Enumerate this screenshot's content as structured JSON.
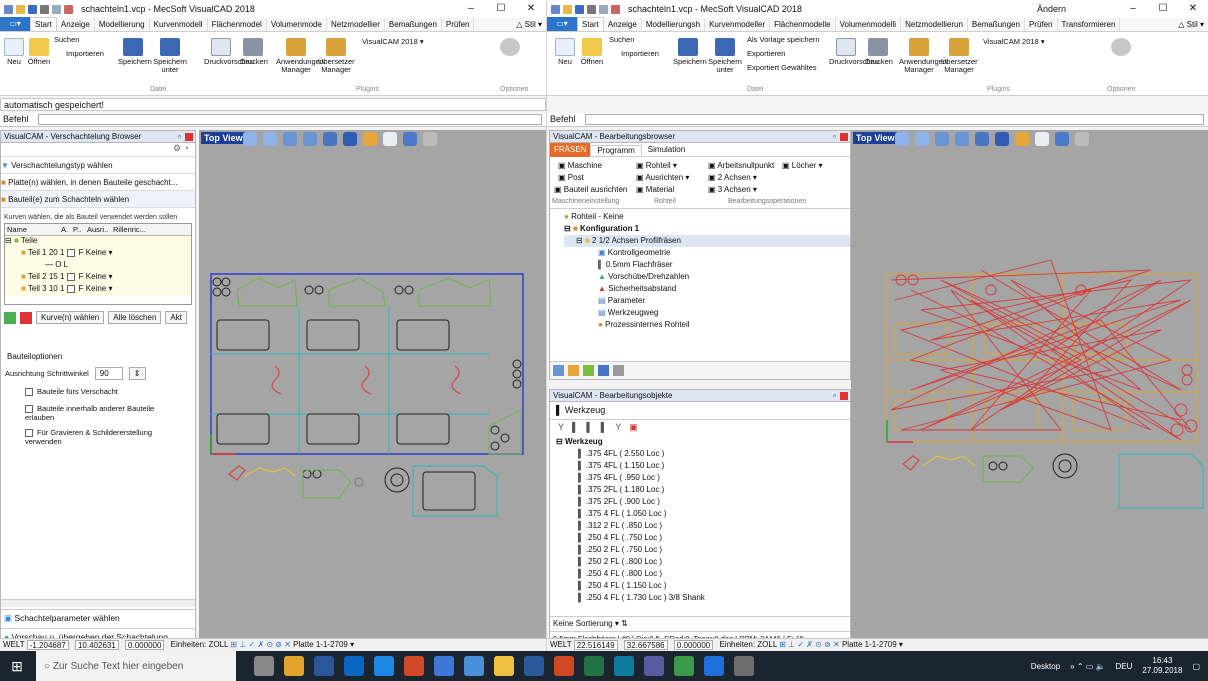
{
  "colors": {
    "accent": "#2b74c7",
    "panel_header": "#dde6f2",
    "viewport_bg": "#a5a5a5",
    "topview_bg": "#1c3f9c"
  },
  "left_window": {
    "title": "schachteln1.vcp - MecSoft VisualCAD 2018",
    "tabs": [
      "Start",
      "Anzeige",
      "Modellierung",
      "Kurvenmodell",
      "Flächenmodel",
      "Volumenmode",
      "Netzmodellier",
      "Bemaßungen",
      "Prüfen"
    ],
    "style_label": "Stil",
    "ribbon": {
      "neu": "Neu",
      "oeffnen": "Öffnen",
      "suchen": "Suchen",
      "importieren": "Importieren",
      "speichern": "Speichern",
      "speichern_unter": "Speichern unter",
      "druckvorschau": "Druckvorschau",
      "drucken": "Drucken",
      "anwendungen": "Anwendungen Manager",
      "uebersetzer": "Übersetzer Manager",
      "visualcam": "VisualCAM 2018",
      "group_datei": "Datei",
      "group_plugins": "Plugins",
      "group_optionen": "Optionen"
    },
    "cmd_history": "automatisch gespeichert!",
    "befehl_label": "Befehl",
    "nesting_panel": {
      "title": "VisualCAM - Verschachtelung Browser",
      "steps": [
        "Verschachtelungstyp wählen",
        "Platte(n) wählen, in denen Bauteile geschacht...",
        "Bauteil(e) zum Schachteln wählen"
      ],
      "hint": "Kurven wählen, die als Bauteil verwendet werden sollen",
      "columns": [
        "Name",
        "A.",
        "P..",
        "Ausri..",
        "Rillenric..."
      ],
      "tree_root": "Teile",
      "parts": [
        {
          "name": "Teil 1",
          "a": "20",
          "p": "1",
          "ausri": "F",
          "rille": "Keine"
        },
        {
          "name": "O L",
          "a": "",
          "p": "",
          "ausri": "",
          "rille": ""
        },
        {
          "name": "Teil 2",
          "a": "15",
          "p": "1",
          "ausri": "F",
          "rille": "Keine"
        },
        {
          "name": "Teil 3",
          "a": "10",
          "p": "1",
          "ausri": "F",
          "rille": "Keine"
        }
      ],
      "btn_kurven": "Kurve(n) wählen",
      "btn_loeschen": "Alle löschen",
      "btn_akt": "Akt",
      "options_title": "Bauteiloptionen",
      "angle_label": "Ausrichtung Schrittwinkel",
      "angle_value": "90",
      "checkboxes": [
        "Bauteile fürs Verschacht",
        "Bauteile innerhalb anderer Bauteile erlauben",
        "Für Gravieren & Schildererstellung verwenden"
      ],
      "footer_steps": [
        "Schachtelparameter wählen",
        "Vorschau u. übergeben der Schachtelung"
      ]
    },
    "viewport_label": "Top View",
    "status": {
      "welt": "WELT",
      "x": "-1.204687",
      "y": "10.402631",
      "z": "0.000000",
      "units": "Einheiten: ZOLL",
      "plate": "Platte 1-1-2709"
    }
  },
  "right_window": {
    "title": "schachteln1.vcp - MecSoft VisualCAD 2018",
    "andern": "Ändern",
    "tabs": [
      "Start",
      "Anzeige",
      "Modellierungsh",
      "Kurvenmodeller",
      "Flächenmodelle",
      "Volumenmodelli",
      "Netzmodellierun",
      "Bemaßungen",
      "Prüfen",
      "Transformieren"
    ],
    "style_label": "Stil",
    "ribbon": {
      "neu": "Neu",
      "oeffnen": "Öffnen",
      "suchen": "Suchen",
      "importieren": "Importieren",
      "speichern": "Speichern",
      "speichern_unter": "Speichern unter",
      "als_vorlage": "Als Vorlage speichern",
      "exportieren": "Exportieren",
      "export_gewaehltes": "Exportiert Gewähltes",
      "druckvorschau": "Druckvorschau",
      "drucken": "Drucken",
      "anwendungen": "Anwendungen Manager",
      "uebersetzer": "Übersetzer Manager",
      "visualcam": "VisualCAM 2018",
      "group_datei": "Datei",
      "group_plugins": "Plugins",
      "group_optionen": "Optionen"
    },
    "befehl_label": "Befehl",
    "machining_browser": {
      "title": "VisualCAM - Bearbeitungsbrowser",
      "fraesen": "FRÄSEN",
      "tabs": [
        "Programm",
        "Simulation"
      ],
      "buttons": [
        "Maschine",
        "Post",
        "Bauteil ausrichten",
        "Rohteil",
        "Ausrichten",
        "Material",
        "Arbeitsnullpunkt",
        "Löcher",
        "2 Achsen",
        "3 Achsen"
      ],
      "groups": [
        "Maschineneinstellung",
        "Rohteil",
        "Bearbeitungsoperationen"
      ],
      "tree": [
        "Rohteil - Keine",
        "Konfiguration 1",
        "2 1/2 Achsen Profilfräsen",
        "Kontrollgeometrie",
        "0.5mm Flachfräser",
        "Vorschübe/Drehzahlen",
        "Sicherheitsabstand",
        "Parameter",
        "Werkzeugweg",
        "Prozessinternes Rohteil"
      ]
    },
    "objects_panel": {
      "title": "VisualCAM - Bearbeitungsobjekte",
      "tab": "Werkzeug",
      "root": "Werkzeug",
      "tools": [
        ".375 4FL ( 2.550 Loc )",
        ".375 4FL ( 1.150 Loc )",
        ".375 4FL ( .950 Loc )",
        ".375 2FL ( 1.180 Loc )",
        ".375 2FL ( .900 Loc )",
        ".375 4 FL ( 1.050 Loc )",
        ".312 2 FL ( .850 Loc )",
        ".250 4 FL ( .750 Loc )",
        ".250 2 FL ( .750 Loc )",
        ".250 2 FL ( .800 Loc )",
        ".250 4 FL ( .800 Loc )",
        ".250 4 FL ( 1.150 Loc )",
        ".250 4 FL ( 1.730 Loc ) 3/8 Shank"
      ],
      "sort": "Keine Sortierung",
      "tool_info": "0.5mm Flachfräser | #0 | Dia:0.5, CRad:0, Taper:0 deg | RPM: 24446 | F: 15"
    },
    "viewport_label": "Top View",
    "status": {
      "welt": "WELT",
      "x": "22.516149",
      "y": "32.667586",
      "z": "0.000000",
      "units": "Einheiten: ZOLL",
      "plate": "Platte 1-1-2709"
    }
  },
  "taskbar": {
    "search_placeholder": "Zur Suche Text hier eingeben",
    "desktop": "Desktop",
    "lang": "DEU",
    "time": "16:43",
    "date": "27.09.2018"
  }
}
